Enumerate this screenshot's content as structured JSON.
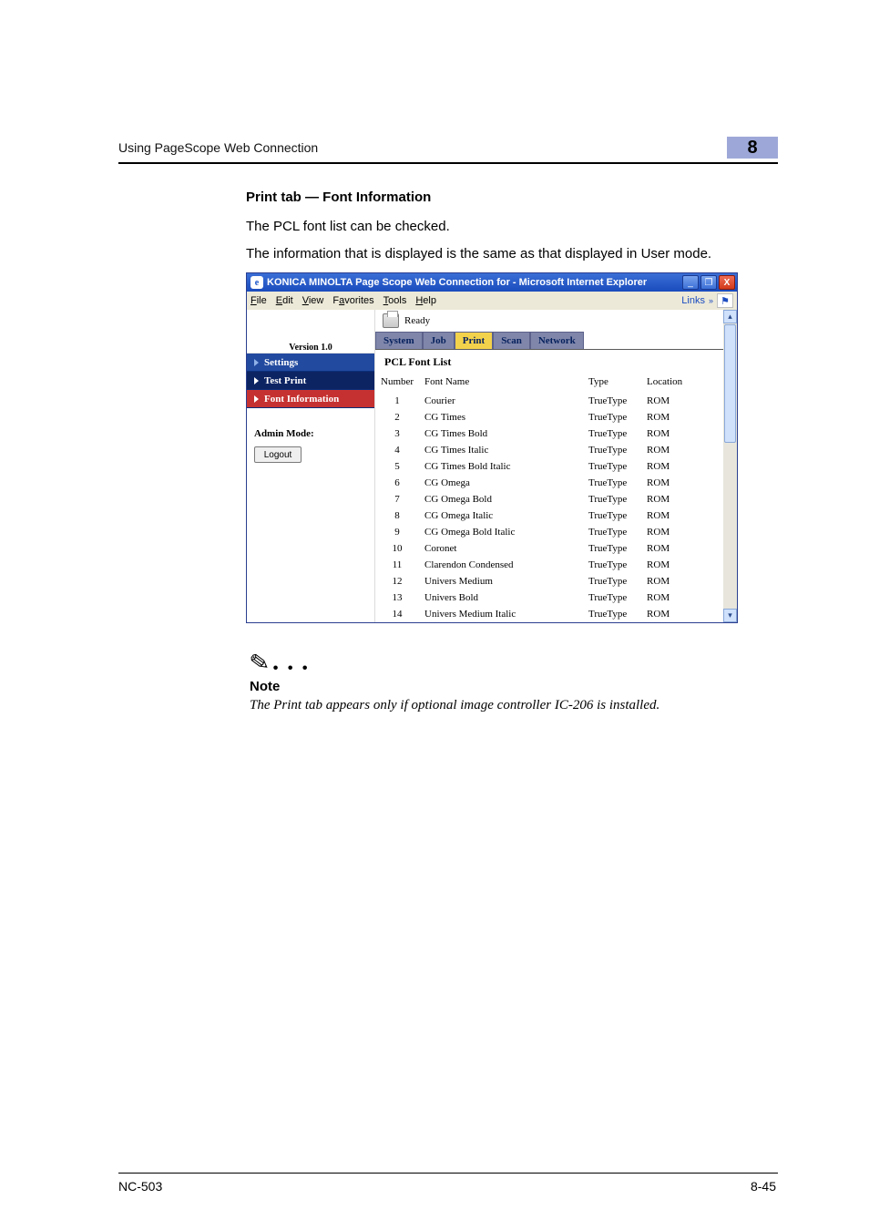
{
  "header": {
    "left": "Using PageScope Web Connection",
    "badge": "8"
  },
  "section_title": "Print tab — Font Information",
  "para1": "The PCL font list can be checked.",
  "para2": "The information that is displayed is the same as that displayed in User mode.",
  "browser": {
    "title": "KONICA MINOLTA Page Scope Web Connection for        - Microsoft Internet Explorer",
    "menu": {
      "file": "File",
      "edit": "Edit",
      "view": "View",
      "favorites": "Favorites",
      "tools": "Tools",
      "help": "Help",
      "links": "Links"
    },
    "version": "Version 1.0",
    "nav": {
      "settings": "Settings",
      "testprint": "Test Print",
      "fontinfo": "Font Information"
    },
    "admin_mode": "Admin Mode:",
    "logout": "Logout",
    "status": "Ready",
    "tabs": {
      "system": "System",
      "job": "Job",
      "print": "Print",
      "scan": "Scan",
      "network": "Network"
    },
    "panel_title": "PCL Font List",
    "columns": {
      "number": "Number",
      "fontname": "Font Name",
      "type": "Type",
      "location": "Location"
    },
    "fonts": [
      {
        "n": "1",
        "name": "Courier",
        "type": "TrueType",
        "loc": "ROM"
      },
      {
        "n": "2",
        "name": "CG Times",
        "type": "TrueType",
        "loc": "ROM"
      },
      {
        "n": "3",
        "name": "CG Times Bold",
        "type": "TrueType",
        "loc": "ROM"
      },
      {
        "n": "4",
        "name": "CG Times Italic",
        "type": "TrueType",
        "loc": "ROM"
      },
      {
        "n": "5",
        "name": "CG Times Bold Italic",
        "type": "TrueType",
        "loc": "ROM"
      },
      {
        "n": "6",
        "name": "CG Omega",
        "type": "TrueType",
        "loc": "ROM"
      },
      {
        "n": "7",
        "name": "CG Omega Bold",
        "type": "TrueType",
        "loc": "ROM"
      },
      {
        "n": "8",
        "name": "CG Omega Italic",
        "type": "TrueType",
        "loc": "ROM"
      },
      {
        "n": "9",
        "name": "CG Omega Bold Italic",
        "type": "TrueType",
        "loc": "ROM"
      },
      {
        "n": "10",
        "name": "Coronet",
        "type": "TrueType",
        "loc": "ROM"
      },
      {
        "n": "11",
        "name": "Clarendon Condensed",
        "type": "TrueType",
        "loc": "ROM"
      },
      {
        "n": "12",
        "name": "Univers Medium",
        "type": "TrueType",
        "loc": "ROM"
      },
      {
        "n": "13",
        "name": "Univers Bold",
        "type": "TrueType",
        "loc": "ROM"
      },
      {
        "n": "14",
        "name": "Univers Medium Italic",
        "type": "TrueType",
        "loc": "ROM"
      }
    ]
  },
  "note": {
    "label": "Note",
    "text": "The Print tab appears only if optional image controller IC-206 is installed."
  },
  "footer": {
    "left": "NC-503",
    "right": "8-45"
  }
}
